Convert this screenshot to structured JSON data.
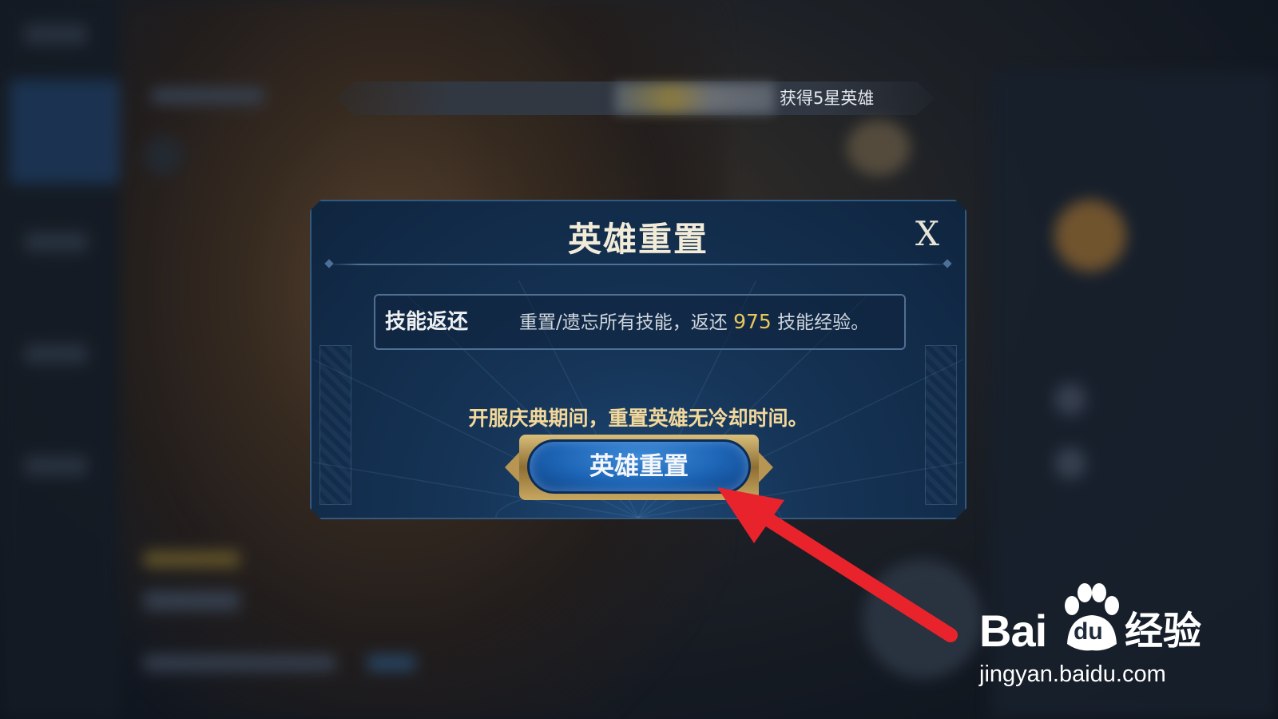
{
  "banner": {
    "text": "获得5星英雄"
  },
  "dialog": {
    "title": "英雄重置",
    "close_label": "X",
    "skill": {
      "label": "技能返还",
      "desc_prefix": "重置/遗忘所有技能，返还",
      "amount": "975",
      "desc_suffix": "技能经验。"
    },
    "notice": "开服庆典期间，重置英雄无冷却时间。",
    "reset_button_label": "英雄重置"
  },
  "watermark": {
    "brand_left": "Bai",
    "brand_paw": "du",
    "brand_right": "经验",
    "url": "jingyan.baidu.com"
  },
  "colors": {
    "dialog_bg": "#163558",
    "accent_gold": "#e8c85a",
    "notice_text": "#f2d89a",
    "button_blue": "#1c63b4",
    "arrow_red": "#e8232b"
  },
  "icons": {
    "close": "close-icon",
    "arrow": "annotation-arrow-icon",
    "paw": "baidu-paw-icon"
  }
}
